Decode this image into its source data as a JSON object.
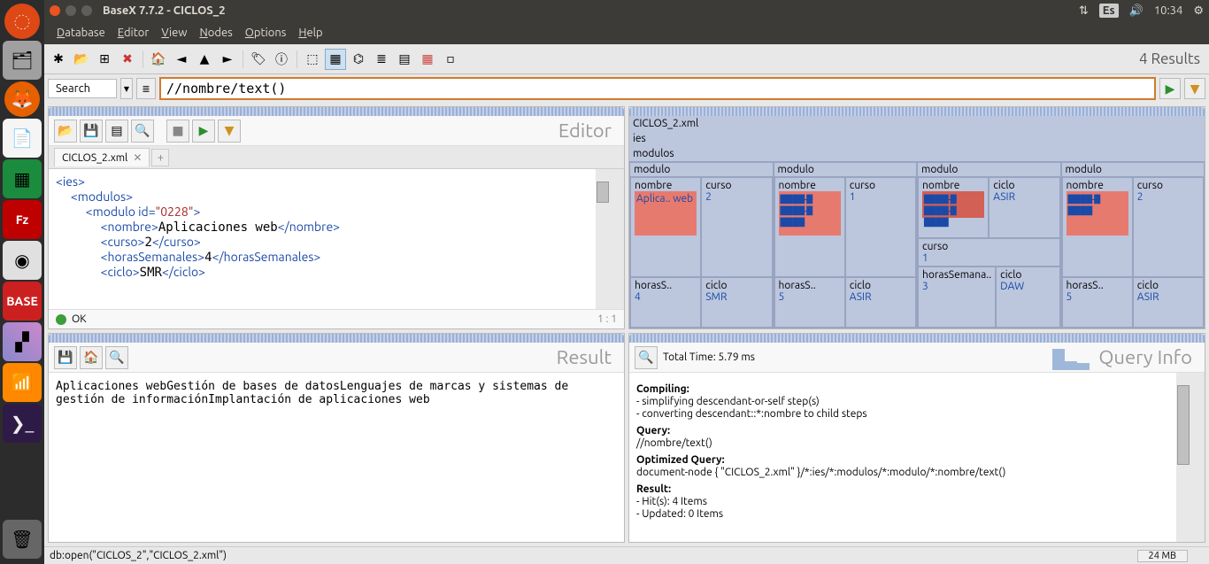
{
  "topbar": {
    "title": "BaseX 7.7.2 - CICLOS_2",
    "lang": "Es",
    "time": "10:34"
  },
  "menu": {
    "database": "Database",
    "editor": "Editor",
    "view": "View",
    "nodes": "Nodes",
    "options": "Options",
    "help": "Help"
  },
  "toolbar": {
    "results": "4 Results"
  },
  "search": {
    "label": "Search",
    "query": "//nombre/text()"
  },
  "editor": {
    "title": "Editor",
    "tab": "CICLOS_2.xml",
    "ok": "OK",
    "cursor": "1 : 1",
    "lines": [
      {
        "t": "<ies>",
        "indent": 0
      },
      {
        "t": "<modulos>",
        "indent": 2
      },
      {
        "t": "<modulo id=\"0228\">",
        "indent": 4
      },
      {
        "t": "<nombre>",
        "c": "Aplicaciones web",
        "ct": "</nombre>",
        "indent": 6
      },
      {
        "t": "<curso>",
        "c": "2",
        "ct": "</curso>",
        "indent": 6
      },
      {
        "t": "<horasSemanales>",
        "c": "4",
        "ct": "</horasSemanales>",
        "indent": 6
      },
      {
        "t": "<ciclo>",
        "c": "SMR",
        "ct": "</ciclo>",
        "indent": 6
      }
    ]
  },
  "treemap": {
    "root": "CICLOS_2.xml",
    "ies": "ies",
    "modulos": "modulos",
    "modulo_label": "modulo",
    "nombre_label": "nombre",
    "curso_label": "curso",
    "horas_label": "horasS..",
    "horas_label_full": "horasSemana..",
    "ciclo_label": "ciclo",
    "m1": {
      "nombre": "Aplica.. web",
      "curso": "2",
      "horas": "4",
      "ciclo": "SMR"
    },
    "m2": {
      "nombre": "",
      "curso": "1",
      "horas": "5",
      "ciclo": "ASIR"
    },
    "m3": {
      "nombre": "",
      "ciclo_top": "ASIR",
      "curso": "1",
      "horas": "3",
      "ciclo": "DAW"
    },
    "m4": {
      "nombre": "",
      "curso": "2",
      "horas": "5",
      "ciclo": "ASIR"
    }
  },
  "result": {
    "title": "Result",
    "text": "Aplicaciones webGestión de bases de datosLenguajes de marcas y sistemas de gestión de informaciónImplantación de aplicaciones web"
  },
  "queryinfo": {
    "title": "Query Info",
    "time": "Total Time: 5.79 ms",
    "compiling_h": "Compiling:",
    "compiling_l1": "- simplifying descendant-or-self step(s)",
    "compiling_l2": "- converting descendant::*:nombre to child steps",
    "query_h": "Query:",
    "query_v": "//nombre/text()",
    "opt_h": "Optimized Query:",
    "opt_v": "document-node { \"CICLOS_2.xml\" }/*:ies/*:modulos/*:modulo/*:nombre/text()",
    "result_h": "Result:",
    "result_l1": "- Hit(s): 4 Items",
    "result_l2": "- Updated: 0 Items"
  },
  "status": {
    "text": "db:open(\"CICLOS_2\",\"CICLOS_2.xml\")",
    "mem": "24 MB"
  }
}
